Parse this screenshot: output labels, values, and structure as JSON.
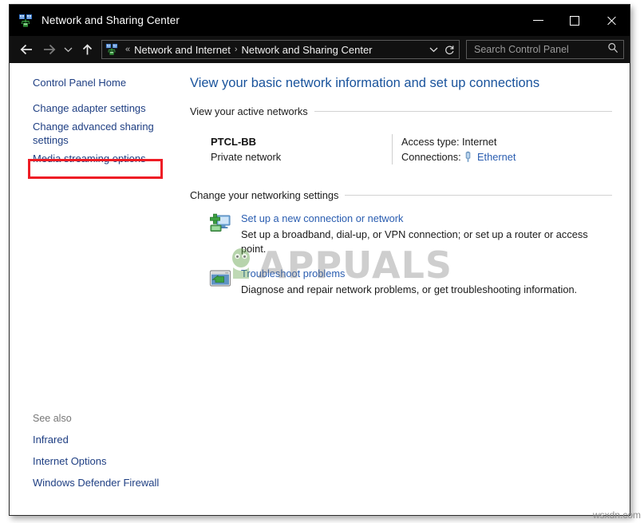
{
  "window": {
    "title": "Network and Sharing Center",
    "app_icon": "network-sharing-icon",
    "minimize_label": "Minimize",
    "maximize_label": "Maximize",
    "close_label": "Close"
  },
  "toolbar": {
    "back_label": "Back",
    "forward_label": "Forward",
    "recent_label": "Recent locations",
    "up_label": "Up one level",
    "breadcrumb": {
      "overflow": "«",
      "items": [
        "Network and Internet",
        "Network and Sharing Center"
      ],
      "separator": "›",
      "dropdown_label": "Previous locations",
      "refresh_label": "Refresh"
    },
    "search": {
      "placeholder": "Search Control Panel",
      "value": "",
      "icon": "search-icon"
    }
  },
  "sidebar": {
    "items": [
      {
        "label": "Control Panel Home",
        "highlighted": false
      },
      {
        "label": "Change adapter settings",
        "highlighted": true
      },
      {
        "label": "Change advanced sharing settings",
        "highlighted": false
      },
      {
        "label": "Media streaming options",
        "highlighted": false
      }
    ],
    "see_also": {
      "title": "See also",
      "items": [
        {
          "label": "Infrared"
        },
        {
          "label": "Internet Options"
        },
        {
          "label": "Windows Defender Firewall"
        }
      ]
    },
    "highlight_color": "#ee1c25"
  },
  "main": {
    "page_title": "View your basic network information and set up connections",
    "active_networks": {
      "heading": "View your active networks",
      "network": {
        "name": "PTCL-BB",
        "type": "Private network"
      },
      "details": [
        {
          "label": "Access type:",
          "value": "Internet",
          "is_link": false
        },
        {
          "label": "Connections:",
          "value": "Ethernet",
          "is_link": true,
          "icon": "ethernet-icon"
        }
      ]
    },
    "networking_settings": {
      "heading": "Change your networking settings",
      "tasks": [
        {
          "icon": "new-connection-icon",
          "link": "Set up a new connection or network",
          "description": "Set up a broadband, dial-up, or VPN connection; or set up a router or access point."
        },
        {
          "icon": "troubleshoot-icon",
          "link": "Troubleshoot problems",
          "description": "Diagnose and repair network problems, or get troubleshooting information."
        }
      ]
    }
  },
  "watermarks": {
    "center": "APPUALS",
    "corner": "wsxdn.com"
  },
  "colors": {
    "titlebar_bg": "#000000",
    "link": "#2a5db0",
    "page_title": "#19539c",
    "highlight": "#ee1c25"
  }
}
